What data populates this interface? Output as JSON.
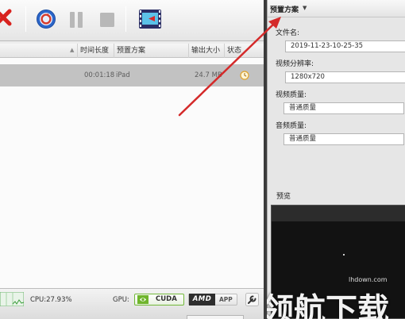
{
  "columns": {
    "duration": "时间长度",
    "preset": "预置方案",
    "output_size": "输出大小",
    "status": "状态"
  },
  "file_row": {
    "duration": "00:01:18",
    "preset": "iPad",
    "size": "24.7 MB"
  },
  "status_bar": {
    "cpu": "CPU:27.93%",
    "gpu_label": "GPU:",
    "cuda": "CUDA",
    "amd": "AMD",
    "app": "APP"
  },
  "panel": {
    "title": "预置方案",
    "filename_label": "文件名:",
    "filename_value": "2019-11-23-10-25-35",
    "resolution_label": "视频分辨率:",
    "resolution_value": "1280x720",
    "video_quality_label": "视频质量:",
    "video_quality_value": "普通质量",
    "audio_quality_label": "音频质量:",
    "audio_quality_value": "普通质量",
    "preview_label": "预览"
  },
  "watermark": {
    "url": "lhdown.com",
    "text": "领航下载"
  },
  "icons": {
    "delete": "x-icon",
    "convert": "convert-icon",
    "pause": "pause-icon",
    "stop": "stop-icon",
    "clip": "film-clip-icon"
  },
  "colors": {
    "delete_red": "#d8231f",
    "convert_blue": "#2c66c9",
    "annotation_arrow": "#d42a2a",
    "selected_row": "#c2c2c2",
    "cuda_green": "#72b83a"
  }
}
